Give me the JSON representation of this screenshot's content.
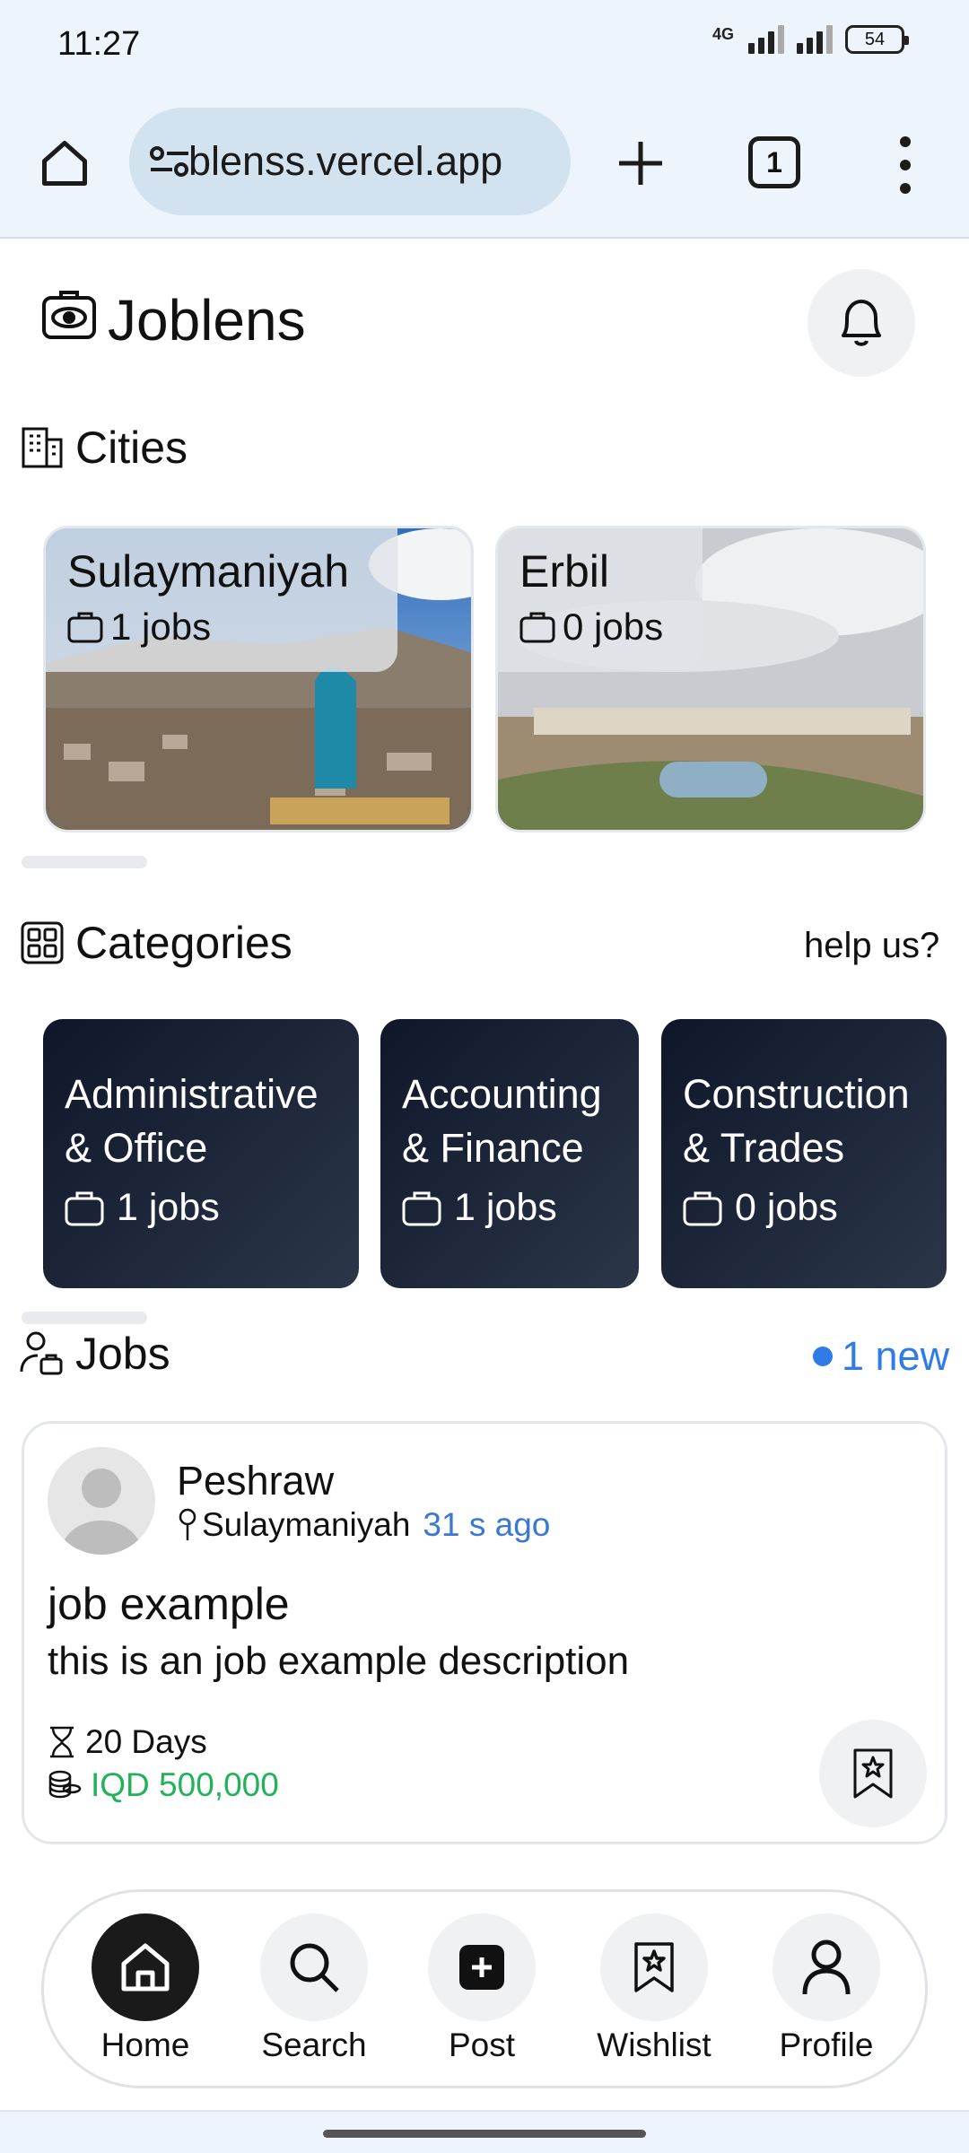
{
  "status_bar": {
    "time": "11:27",
    "network": "4G",
    "battery": "54"
  },
  "browser": {
    "url": "blenss.vercel.app",
    "tab_count": "1"
  },
  "app": {
    "title": "Joblens"
  },
  "cities": {
    "title": "Cities",
    "items": [
      {
        "name": "Sulaymaniyah",
        "jobs": "1 jobs"
      },
      {
        "name": "Erbil",
        "jobs": "0 jobs"
      }
    ]
  },
  "categories": {
    "title": "Categories",
    "help_link": "help us?",
    "items": [
      {
        "name_line1": "Administrative",
        "name_line2": "& Office",
        "jobs": "1 jobs"
      },
      {
        "name_line1": "Accounting",
        "name_line2": "& Finance",
        "jobs": "1 jobs"
      },
      {
        "name_line1": "Construction",
        "name_line2": "& Trades",
        "jobs": "0 jobs"
      }
    ]
  },
  "jobs": {
    "title": "Jobs",
    "new_badge": "1 new",
    "items": [
      {
        "poster": "Peshraw",
        "location": "Sulaymaniyah",
        "time_ago": "31 s ago",
        "title": "job example",
        "description": "this is an job example description",
        "duration": "20 Days",
        "salary": "IQD 500,000"
      }
    ]
  },
  "nav": {
    "items": [
      {
        "label": "Home",
        "icon": "home-icon",
        "active": true
      },
      {
        "label": "Search",
        "icon": "search-icon"
      },
      {
        "label": "Post",
        "icon": "plus-square-icon"
      },
      {
        "label": "Wishlist",
        "icon": "bookmark-star-icon"
      },
      {
        "label": "Profile",
        "icon": "person-icon"
      }
    ]
  },
  "colors": {
    "accent": "#2f7be8",
    "salary": "#22b35a",
    "category_bg": "#1b2336"
  }
}
